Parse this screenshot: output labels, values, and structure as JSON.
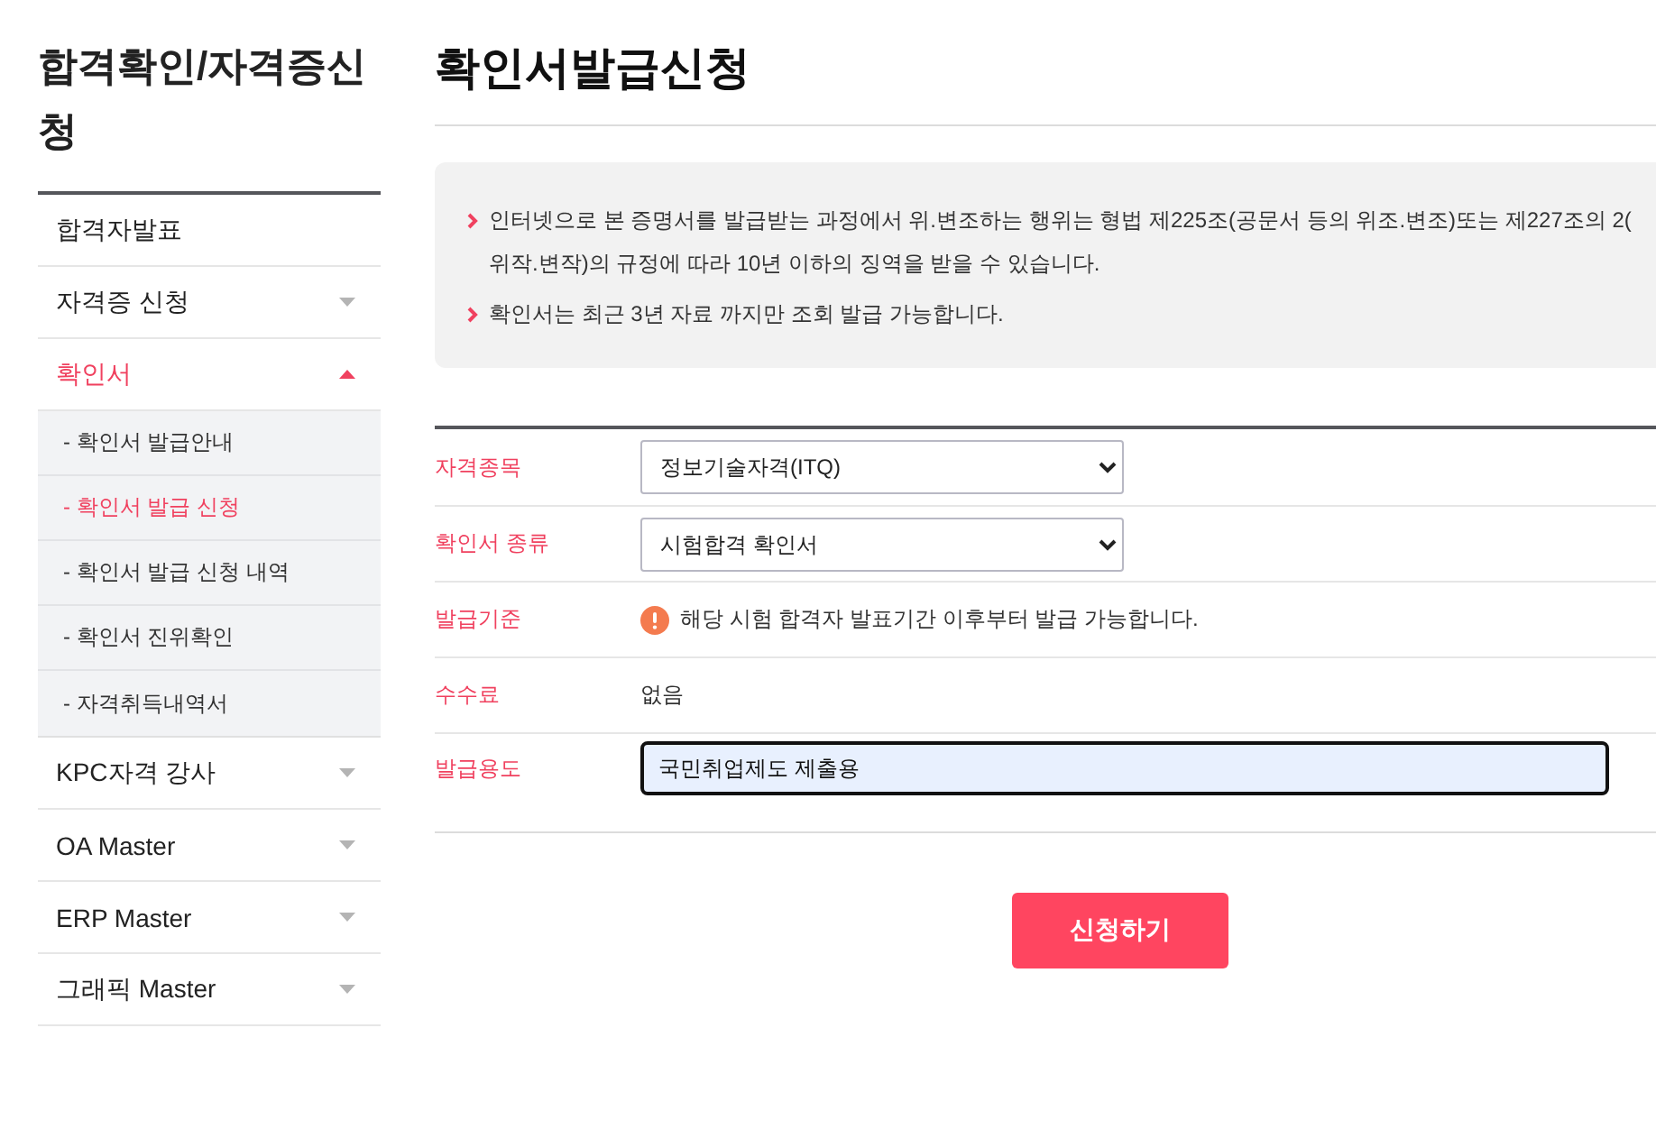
{
  "sidebar": {
    "title": "합격확인/자격증신청",
    "items": [
      {
        "label": "합격자발표",
        "kind": "link",
        "selected": false
      },
      {
        "label": "자격증 신청",
        "kind": "group",
        "expanded": false,
        "selected": false
      },
      {
        "label": "확인서",
        "kind": "group",
        "expanded": true,
        "selected": true,
        "children": [
          {
            "label": "- 확인서 발급안내",
            "selected": false
          },
          {
            "label": "- 확인서 발급 신청",
            "selected": true
          },
          {
            "label": "- 확인서 발급 신청 내역",
            "selected": false
          },
          {
            "label": "- 확인서 진위확인",
            "selected": false
          },
          {
            "label": "- 자격취득내역서",
            "selected": false
          }
        ]
      },
      {
        "label": "KPC자격 강사",
        "kind": "group",
        "expanded": false,
        "selected": false
      },
      {
        "label": "OA Master",
        "kind": "group",
        "expanded": false,
        "selected": false
      },
      {
        "label": "ERP Master",
        "kind": "group",
        "expanded": false,
        "selected": false
      },
      {
        "label": "그래픽 Master",
        "kind": "group",
        "expanded": false,
        "selected": false
      }
    ]
  },
  "page": {
    "title": "확인서발급신청"
  },
  "notice": {
    "items": [
      {
        "lines": [
          "인터넷으로 본 증명서를 발급받는 과정에서 위.변조하는 행위는 형법 제225조(공문서 등의 위조.변조)또는 제227조의 2(",
          "위작.변작)의 규정에 따라 10년 이하의 징역을 받을 수 있습니다."
        ]
      },
      {
        "lines": [
          "확인서는 최근 3년 자료 까지만 조회 발급 가능합니다."
        ]
      }
    ]
  },
  "form": {
    "rows": [
      {
        "label": "자격종목",
        "kind": "select",
        "value": "정보기술자격(ITQ)"
      },
      {
        "label": "확인서 종류",
        "kind": "select",
        "value": "시험합격 확인서"
      },
      {
        "label": "발급기준",
        "kind": "notice",
        "value": "해당 시험 합격자 발표기간 이후부터 발급 가능합니다."
      },
      {
        "label": "수수료",
        "kind": "text",
        "value": "없음"
      },
      {
        "label": "발급용도",
        "kind": "input",
        "value": "국민취업제도 제출용",
        "focused": true
      }
    ]
  },
  "submit_button": {
    "label": "신청하기"
  }
}
